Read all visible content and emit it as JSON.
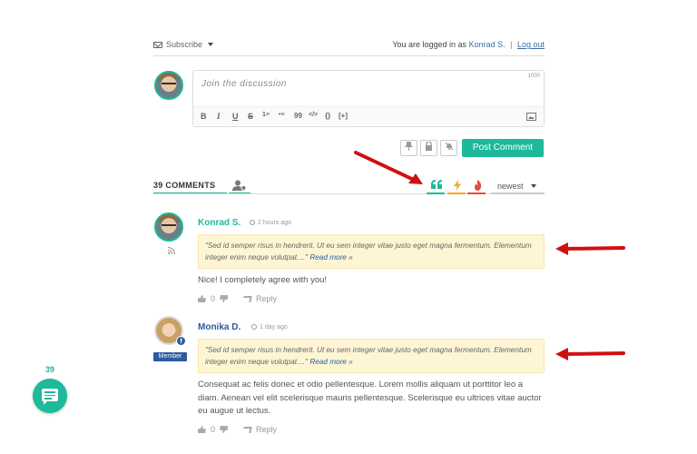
{
  "topbar": {
    "subscribe_label": "Subscribe",
    "logged_in_prefix": "You are logged in as",
    "user_name": "Konrad S.",
    "separator": "|",
    "logout_label": "Log out"
  },
  "composer": {
    "placeholder": "Join the discussion",
    "char_limit": "1000",
    "toolbar": [
      "B",
      "I",
      "U",
      "S",
      "1≡",
      "•≡",
      "99",
      "</>",
      "{}",
      "[+]"
    ],
    "post_label": "Post Comment"
  },
  "tabs": {
    "count_label": "39 COMMENTS",
    "sort_label": "newest"
  },
  "colors": {
    "accent": "#1db99a",
    "quote_bg": "#fef5d4",
    "arrow": "#d01010",
    "link": "#3a6ea5",
    "fire": "#e74c3c",
    "bolt": "#f5a623"
  },
  "comments": [
    {
      "author": "Konrad S.",
      "author_color": "#1db99a",
      "time": "2 hours ago",
      "quote": "\"Sed id semper risus in hendrerit. Ut eu sem integer vitae justo eget magna fermentum. Elementum integer enim neque volutpat....\"",
      "read_more": "Read more »",
      "text": "Nice! I completely agree with you!",
      "votes": "0",
      "reply_label": "Reply"
    },
    {
      "author": "Monika D.",
      "author_color": "#2d5aa0",
      "time": "1 day ago",
      "badge": "Member",
      "quote": "\"Sed id semper risus in hendrerit. Ut eu sem integer vitae justo eget magna fermentum. Elementum integer enim neque volutpat....\"",
      "read_more": "Read more »",
      "text": "Consequat ac felis donec et odio pellentesque. Lorem mollis aliquam ut porttitor leo a diam. Aenean vel elit scelerisque mauris pellentesque. Scelerisque eu ultrices vitae auctor eu augue ut lectus.",
      "votes": "0",
      "reply_label": "Reply"
    }
  ],
  "fab": {
    "count": "39"
  }
}
